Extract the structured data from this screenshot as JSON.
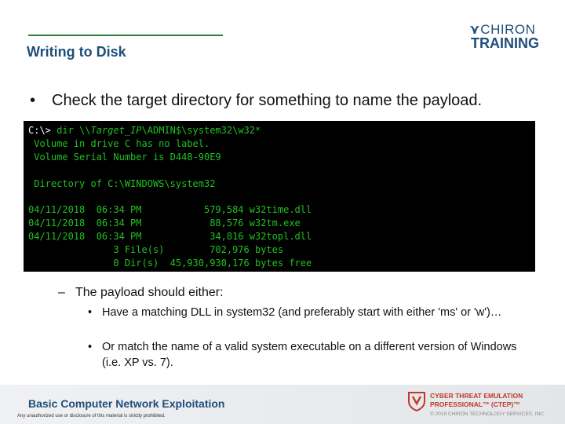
{
  "header": {
    "title": "Writing to Disk",
    "logo_top": "CHIRON",
    "logo_bottom": "TRAINING"
  },
  "main": {
    "bullet": "Check the target directory for something to name the payload.",
    "console": {
      "prompt": "C:\\> ",
      "cmd_dir": "dir \\\\",
      "cmd_target": "Target_IP",
      "cmd_path": "\\ADMIN$\\system32\\w32*",
      "lines": [
        " Volume in drive C has no label.",
        " Volume Serial Number is D448-90E9",
        "",
        " Directory of C:\\WINDOWS\\system32",
        "",
        "04/11/2018  06:34 PM           579,584 w32time.dll",
        "04/11/2018  06:34 PM            88,576 w32tm.exe",
        "04/11/2018  06:34 PM            34,816 w32topl.dll",
        "               3 File(s)        702,976 bytes",
        "               0 Dir(s)  45,930,930,176 bytes free"
      ]
    },
    "sub_bullet": "The payload should either:",
    "sub_items": [
      "Have a matching DLL in system32 (and preferably start with either 'ms' or 'w')…",
      "Or match the name of a valid system executable on a different version of Windows (i.e. XP vs. 7)."
    ]
  },
  "footer": {
    "course": "Basic Computer Network Exploitation",
    "legal": "Any unauthorized use or disclosure of this material is strictly prohibited.",
    "brand_line1": "CYBER THREAT EMULATION",
    "brand_line2": "PROFESSIONAL™ (CTEP)™",
    "copyright": "© 2019 CHIRON TECHNOLOGY SERVICES, INC."
  },
  "colors": {
    "title": "#1f4e79",
    "accent_line": "#2e7d3a",
    "console_bg": "#000000",
    "console_text": "#22c022",
    "brand_red": "#c0392b"
  }
}
